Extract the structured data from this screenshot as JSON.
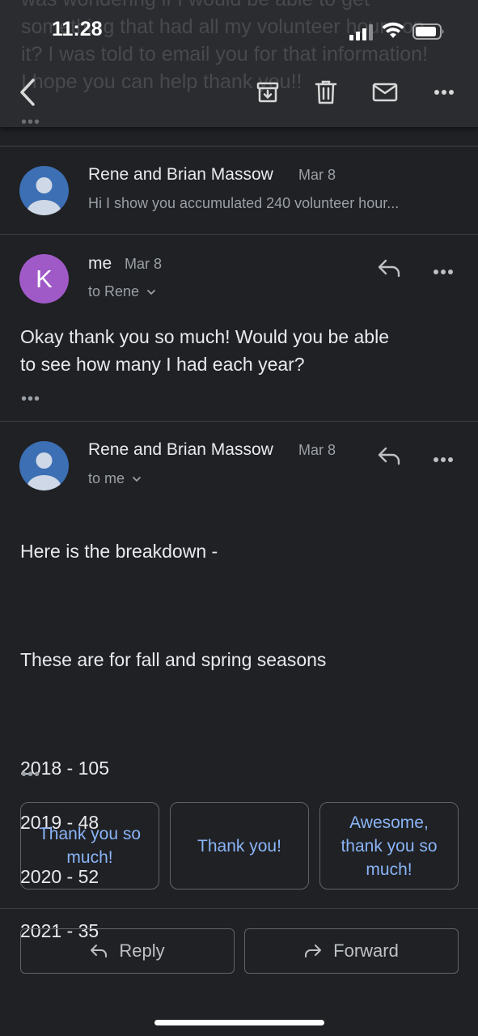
{
  "status_bar": {
    "time": "11:28"
  },
  "background_text": {
    "lines": "was wondering if I would be able to get\nsomething that had all my volunteer hours on\nit? I was told to email you for that information!\nI hope you can help thank you!!",
    "ellipsis": "•••"
  },
  "toolbar": {
    "icons": [
      "back-icon",
      "archive-icon",
      "delete-icon",
      "mail-icon",
      "more-icon"
    ]
  },
  "messages": [
    {
      "sender": "Rene and Brian Massow",
      "date": "Mar 8",
      "snippet": "Hi I show you accumulated 240 volunteer hour...",
      "avatar": "person",
      "avatar_color": "#3c6fb4"
    },
    {
      "sender": "me",
      "date": "Mar 8",
      "to": "to Rene",
      "avatar_letter": "K",
      "avatar_color": "#a05ac8",
      "body": "Okay thank you so much! Would you be able\nto see how many I had each year?",
      "ellipsis": "•••"
    },
    {
      "sender": "Rene and Brian Massow",
      "date": "Mar 8",
      "to": "to me",
      "avatar": "person",
      "avatar_color": "#3c6fb4",
      "body_lines": [
        "Here is the breakdown -",
        "",
        "These are for fall and spring seasons",
        "",
        "2018 - 105",
        "2019 - 48",
        "2020 - 52",
        "2021 - 35"
      ],
      "ellipsis": "•••"
    }
  ],
  "smart_replies": [
    "Thank you so much!",
    "Thank you!",
    "Awesome, thank you so much!"
  ],
  "actions": {
    "reply": "Reply",
    "forward": "Forward"
  },
  "colors": {
    "background": "#202124",
    "accent": "#8ab4f8",
    "text": "#e8eaed",
    "muted": "#9aa0a6"
  }
}
